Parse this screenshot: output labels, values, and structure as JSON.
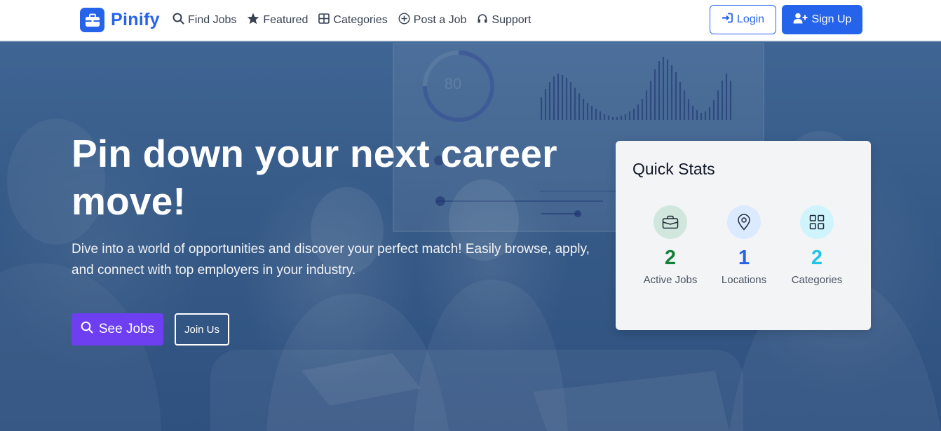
{
  "brand": {
    "name": "Pinify",
    "color": "#2563eb"
  },
  "nav": {
    "links": [
      {
        "label": "Find Jobs",
        "icon": "search-icon"
      },
      {
        "label": "Featured",
        "icon": "star-icon"
      },
      {
        "label": "Categories",
        "icon": "grid-icon"
      },
      {
        "label": "Post a Job",
        "icon": "plus-circle-icon"
      },
      {
        "label": "Support",
        "icon": "headset-icon"
      }
    ],
    "login_label": "Login",
    "signup_label": "Sign Up"
  },
  "hero": {
    "title": "Pin down your next career move!",
    "subtitle": "Dive into a world of opportunities and discover your perfect match! Easily browse, apply, and connect with top employers in your industry.",
    "see_jobs_label": "See Jobs",
    "join_us_label": "Join Us",
    "background_gauge_text": "80"
  },
  "quick_stats": {
    "title": "Quick Stats",
    "items": [
      {
        "value": "2",
        "label": "Active Jobs",
        "icon": "briefcase-icon",
        "color": "#15803d",
        "bg": "#d1e7dd"
      },
      {
        "value": "1",
        "label": "Locations",
        "icon": "map-pin-icon",
        "color": "#2563eb",
        "bg": "#dbeafe"
      },
      {
        "value": "2",
        "label": "Categories",
        "icon": "grid-icon",
        "color": "#22c3e6",
        "bg": "#cff4fc"
      }
    ]
  },
  "colors": {
    "primary": "#2563eb",
    "accent_purple": "#6d3ff0",
    "hero_overlay": "#365a87"
  }
}
